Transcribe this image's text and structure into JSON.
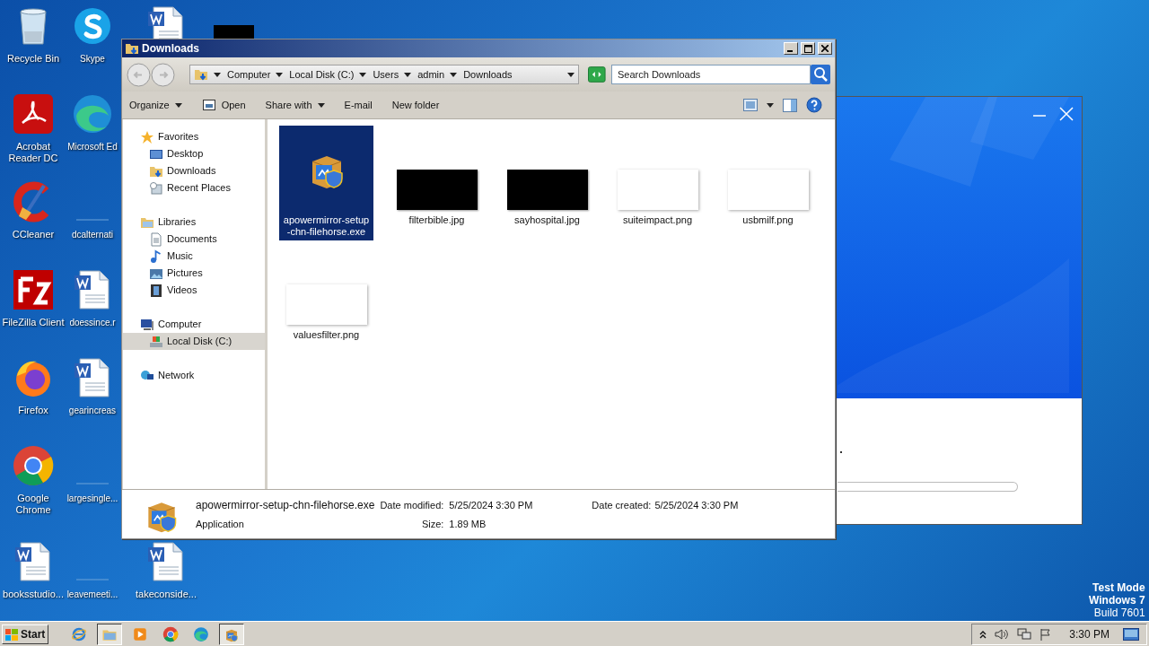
{
  "desktop_icons": [
    {
      "label": "Recycle Bin",
      "kind": "recycle"
    },
    {
      "label": "Acrobat Reader DC",
      "kind": "acrobat"
    },
    {
      "label": "CCleaner",
      "kind": "ccleaner"
    },
    {
      "label": "FileZilla Client",
      "kind": "filezilla"
    },
    {
      "label": "Firefox",
      "kind": "firefox"
    },
    {
      "label": "Google Chrome",
      "kind": "chrome"
    },
    {
      "label": "booksstudio...",
      "kind": "word"
    },
    {
      "label": "Skype",
      "kind": "skype"
    },
    {
      "label": "Microsoft Ed",
      "kind": "edge"
    },
    {
      "label": "dcalternati",
      "kind": "blank"
    },
    {
      "label": "doessince.r",
      "kind": "word"
    },
    {
      "label": "gearincreas",
      "kind": "word"
    },
    {
      "label": "largesingle...",
      "kind": "blank"
    },
    {
      "label": "leavemeeti...",
      "kind": "blank"
    },
    {
      "kind": "word"
    },
    {
      "label": "takeconside...",
      "kind": "word"
    },
    {
      "kind": "dark"
    }
  ],
  "installer_window": {
    "progress": {
      "level": 0
    }
  },
  "explorer": {
    "title": "Downloads",
    "breadcrumb": [
      "Computer",
      "Local Disk (C:)",
      "Users",
      "admin",
      "Downloads"
    ],
    "search": {
      "placeholder": "Search Downloads"
    },
    "toolbar": [
      {
        "label": "Organize",
        "kind": "menu"
      },
      {
        "label": "Open",
        "kind": "open"
      },
      {
        "label": "Share with",
        "kind": "menu"
      },
      {
        "label": "E-mail",
        "kind": "plain"
      },
      {
        "label": "New folder",
        "kind": "plain"
      }
    ],
    "nav": [
      {
        "label": "Favorites",
        "kind": "star",
        "selected": false,
        "children": [
          {
            "label": "Desktop",
            "kind": "desktop",
            "selected": false
          },
          {
            "label": "Downloads",
            "kind": "downloads",
            "selected": false
          },
          {
            "label": "Recent Places",
            "kind": "recent",
            "selected": false
          }
        ]
      },
      {
        "label": "Libraries",
        "kind": "libraries",
        "selected": false,
        "children": [
          {
            "label": "Documents",
            "kind": "documents",
            "selected": false
          },
          {
            "label": "Music",
            "kind": "music",
            "selected": false
          },
          {
            "label": "Pictures",
            "kind": "pictures",
            "selected": false
          },
          {
            "label": "Videos",
            "kind": "videos",
            "selected": false
          }
        ]
      },
      {
        "label": "Computer",
        "kind": "computer",
        "selected": false,
        "children": [
          {
            "label": "Local Disk (C:)",
            "kind": "disk",
            "selected": true
          }
        ]
      },
      {
        "label": "Network",
        "kind": "network",
        "selected": false
      }
    ],
    "files": [
      {
        "name_lines": [
          "apowermirror-setup",
          "-chn-filehorse.exe"
        ],
        "kind": "installer",
        "selected": true
      },
      {
        "name_lines": [
          "filterbible.jpg"
        ],
        "kind": "dark",
        "selected": false
      },
      {
        "name_lines": [
          "sayhospital.jpg"
        ],
        "kind": "dark",
        "selected": false
      },
      {
        "name_lines": [
          "suiteimpact.png"
        ],
        "kind": "light",
        "selected": false
      },
      {
        "name_lines": [
          "usbmilf.png"
        ],
        "kind": "light",
        "selected": false
      },
      {
        "name_lines": [
          "valuesfilter.png"
        ],
        "kind": "light",
        "selected": false
      }
    ],
    "details": {
      "name": "apowermirror-setup-chn-filehorse.exe",
      "type": "Application",
      "modified_label": "Date modified:",
      "modified": "5/25/2024 3:30 PM",
      "created_label": "Date created:",
      "created": "5/25/2024 3:30 PM",
      "size_label": "Size:",
      "size": "1.89 MB"
    }
  },
  "desktop_notice": [
    {
      "text": "Test Mode",
      "bold": true
    },
    {
      "text": "Windows 7",
      "bold": true
    },
    {
      "text": "Build 7601",
      "bold": false
    }
  ],
  "taskbar": {
    "start": "Start",
    "apps": [
      {
        "kind": "ie",
        "active": false
      },
      {
        "kind": "folder",
        "active": true
      },
      {
        "kind": "media",
        "active": false
      },
      {
        "kind": "chrome",
        "active": false
      },
      {
        "kind": "edge",
        "active": false
      },
      {
        "kind": "installer",
        "active": true
      }
    ],
    "clock": "3:30 PM"
  }
}
